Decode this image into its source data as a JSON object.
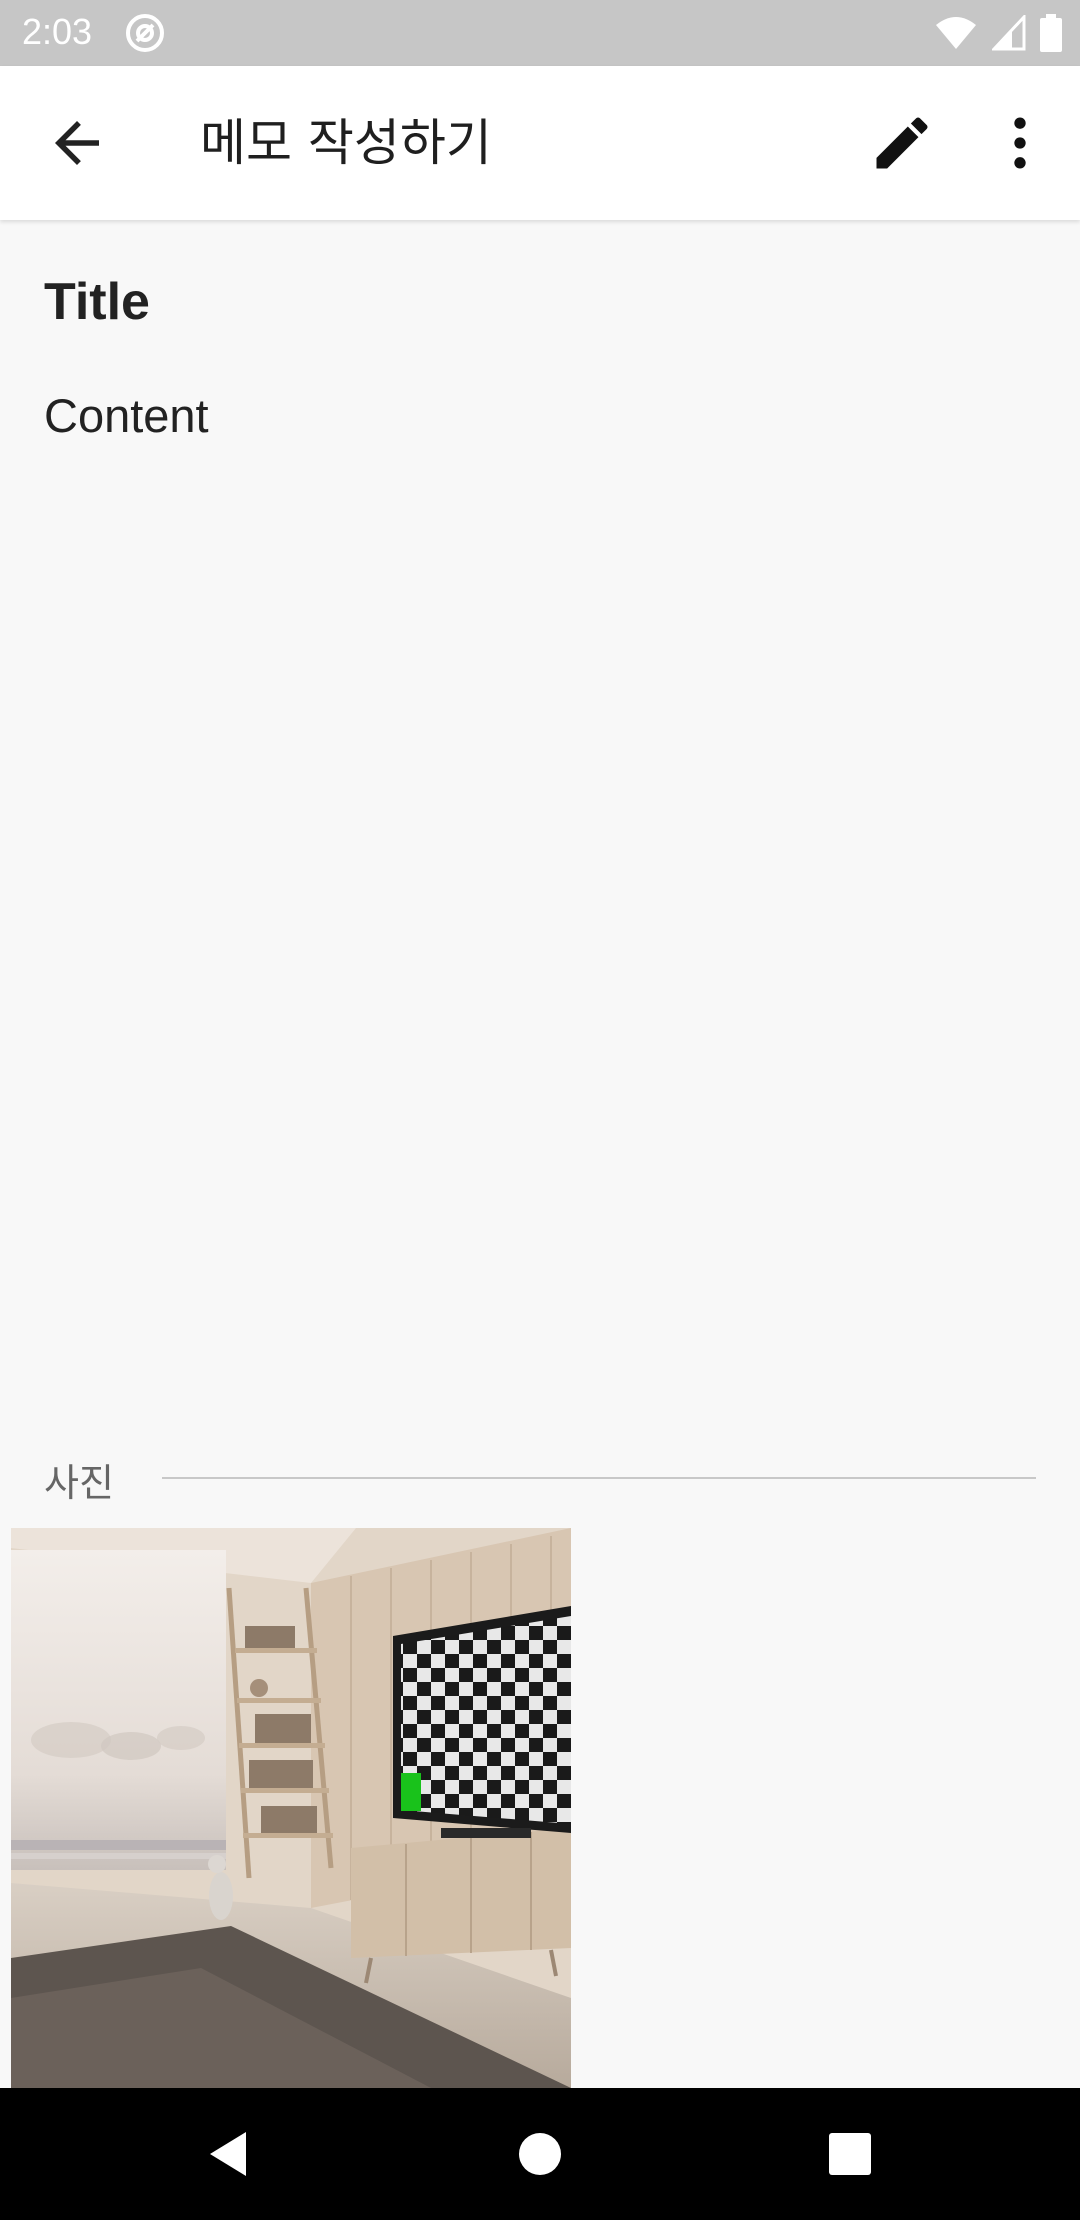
{
  "status_bar": {
    "time": "2:03"
  },
  "app_bar": {
    "title": "메모 작성하기"
  },
  "memo": {
    "title": "Title",
    "content": "Content"
  },
  "photos": {
    "section_label": "사진"
  },
  "icons": {
    "back": "arrow-back-icon",
    "edit": "pencil-icon",
    "more": "more-vert-icon",
    "nav_back": "triangle-back-icon",
    "nav_home": "circle-home-icon",
    "nav_recents": "square-recents-icon"
  },
  "colors": {
    "status_bar_bg": "#c6c6c6",
    "app_bar_bg": "#ffffff",
    "page_bg": "#f8f8f8",
    "nav_bar_bg": "#000000"
  }
}
